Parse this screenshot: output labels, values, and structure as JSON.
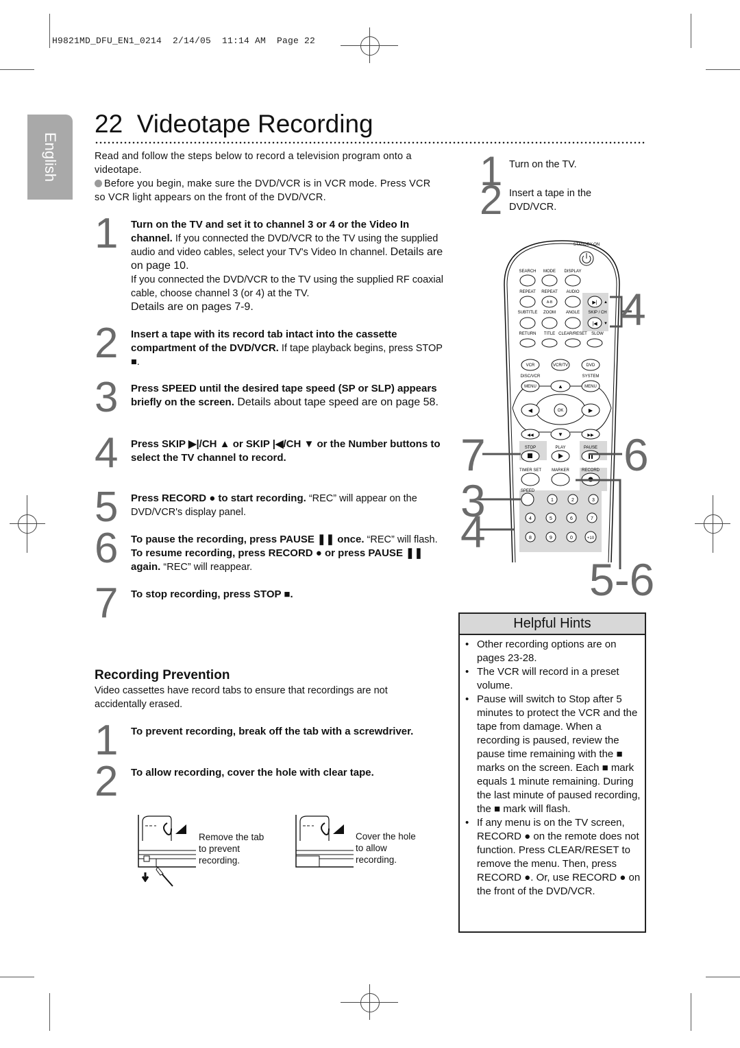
{
  "print_header": "H9821MD_DFU_EN1_0214  2/14/05  11:14 AM  Page 22",
  "language_tab": "English",
  "page_title": "22  Videotape Recording",
  "intro": {
    "line": "Read and follow the steps below to record a television program onto a videotape.",
    "bullet": "Before you begin, make sure the DVD/VCR is in VCR mode. Press VCR so VCR light appears on the front of the DVD/VCR."
  },
  "steps": [
    {
      "num": "1",
      "bold": "Turn on the TV and set it to channel 3 or 4 or the Video In channel.",
      "text": " If you connected the DVD/VCR to the TV using the supplied audio and video cables, select your TV's Video In channel. ",
      "extra": "Details are on page 10.",
      "text2": "If you connected the DVD/VCR to the TV using the supplied RF coaxial cable, choose channel 3 (or 4) at the TV.",
      "extra2": "Details are on pages 7-9."
    },
    {
      "num": "2",
      "bold": "Insert a tape with its record tab intact into the cassette compartment of the DVD/VCR.",
      "text": " If tape playback begins, press STOP ■."
    },
    {
      "num": "3",
      "bold": "Press SPEED until the desired tape speed (SP or SLP) appears briefly on the screen.",
      "text": " Details about tape speed are on page 58."
    },
    {
      "num": "4",
      "bold": "Press SKIP ▶|/CH ▲ or SKIP |◀/CH ▼ or the Number buttons to select the TV channel to record.",
      "text": ""
    },
    {
      "num": "5",
      "bold": "Press RECORD ● to start recording.",
      "text": " “REC” will appear on the DVD/VCR's display panel."
    },
    {
      "num": "6",
      "bold": "To pause the recording, press PAUSE ❚❚ once.",
      "text": " “REC” will flash. ",
      "bold2": "To resume recording, press RECORD ● or press PAUSE ❚❚ again.",
      "text2": " “REC” will reappear."
    },
    {
      "num": "7",
      "bold": "To stop recording, press STOP ■.",
      "text": ""
    }
  ],
  "prevention": {
    "heading": "Recording Prevention",
    "intro": "Video cassettes have record tabs to ensure that recordings are not accidentally erased.",
    "steps": [
      {
        "num": "1",
        "bold": "To prevent recording, break off the tab with a screwdriver."
      },
      {
        "num": "2",
        "bold": "To allow recording, cover the hole with clear tape."
      }
    ],
    "captions": [
      "Remove the tab to prevent recording.",
      "Cover the hole to allow recording."
    ]
  },
  "right_steps": [
    {
      "num": "1",
      "text": "Turn on the TV."
    },
    {
      "num": "2",
      "text": "Insert a tape in the DVD/VCR."
    }
  ],
  "remote": {
    "standby": "STANDBY-ON",
    "row1": [
      "SEARCH",
      "MODE",
      "DISPLAY"
    ],
    "row2": [
      "REPEAT",
      "REPEAT",
      "AUDIO"
    ],
    "ab": "A-B",
    "row3": [
      "SUBTITLE",
      "ZOOM",
      "ANGLE",
      "SKIP / CH"
    ],
    "row4": [
      "RETURN",
      "TITLE",
      "CLEAR/RESET",
      "SLOW"
    ],
    "mode_buttons": [
      "VCR",
      "VCR/TV",
      "DVD"
    ],
    "disc_vcr": "DISC/VCR",
    "system": "SYSTEM",
    "menu": "MENU",
    "ok": "OK",
    "transport": [
      "STOP",
      "PLAY",
      "PAUSE"
    ],
    "row_timer": [
      "TIMER SET",
      "MARKER",
      "RECORD"
    ],
    "speed": "SPEED",
    "numbers": [
      "1",
      "2",
      "3",
      "4",
      "5",
      "6",
      "7",
      "8",
      "9",
      "0",
      "+10"
    ]
  },
  "callouts": {
    "c4a": "4",
    "c7": "7",
    "c6": "6",
    "c3": "3",
    "c4b": "4",
    "c56": "5-6"
  },
  "hints": {
    "title": "Helpful Hints",
    "items": [
      "Other recording options are on pages 23-28.",
      "The VCR will record in a preset volume.",
      "Pause will switch to Stop after 5 minutes to protect the VCR and the tape from damage. When a recording is paused, review the pause time remaining with the ■ marks on the screen. Each ■ mark equals 1 minute remaining. During the last minute of paused recording, the ■ mark will flash.",
      "If any menu is on the TV screen, RECORD ● on the remote does not function. Press CLEAR/RESET to remove the menu. Then, press RECORD ●. Or, use RECORD ● on the front of the DVD/VCR."
    ]
  }
}
